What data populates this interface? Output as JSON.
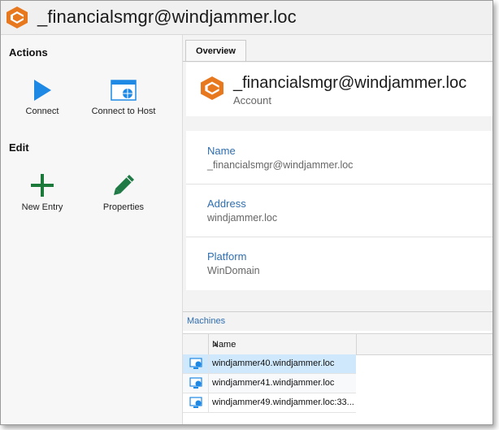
{
  "window": {
    "title": "_financialsmgr@windjammer.loc"
  },
  "sidebar": {
    "sections": [
      {
        "title": "Actions",
        "items": [
          {
            "label": "Connect",
            "icon": "play-icon"
          },
          {
            "label": "Connect to Host",
            "icon": "connect-host-icon"
          }
        ]
      },
      {
        "title": "Edit",
        "items": [
          {
            "label": "New Entry",
            "icon": "plus-icon"
          },
          {
            "label": "Properties",
            "icon": "pencil-icon"
          }
        ]
      }
    ]
  },
  "main": {
    "tabs": [
      {
        "label": "Overview"
      }
    ],
    "header": {
      "title": "_financialsmgr@windjammer.loc",
      "subtitle": "Account"
    },
    "fields": [
      {
        "label": "Name",
        "value": "_financialsmgr@windjammer.loc"
      },
      {
        "label": "Address",
        "value": "windjammer.loc"
      },
      {
        "label": "Platform",
        "value": "WinDomain"
      }
    ],
    "machines": {
      "title": "Machines",
      "column_header": "Name",
      "rows": [
        {
          "name": "windjammer40.windjammer.loc",
          "selected": true
        },
        {
          "name": "windjammer41.windjammer.loc",
          "selected": false
        },
        {
          "name": "windjammer49.windjammer.loc:33...",
          "selected": false
        }
      ]
    }
  },
  "colors": {
    "brand_orange": "#e8781e",
    "play_blue": "#1e88e5",
    "plus_green": "#1b7a3a",
    "pencil_green": "#1f7a45",
    "link_blue": "#2e6db0",
    "selection": "#cfe8fb"
  }
}
